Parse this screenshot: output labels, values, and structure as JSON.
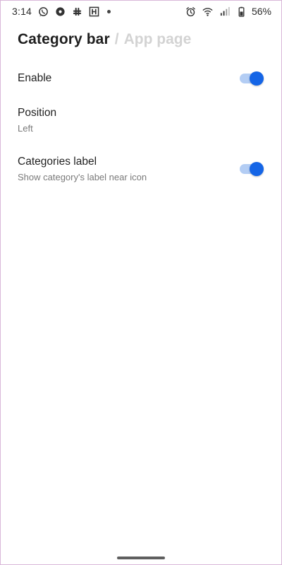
{
  "status_bar": {
    "time": "3:14",
    "battery_percent": "56%",
    "left_icons": [
      "whatsapp-icon",
      "lens-icon",
      "slack-icon",
      "hinge-icon"
    ],
    "right_icons": [
      "alarm-icon",
      "wifi-icon",
      "signal-icon",
      "battery-icon"
    ]
  },
  "header": {
    "title": "Category bar",
    "separator": "/",
    "subtitle": "App page"
  },
  "settings": {
    "enable": {
      "title": "Enable",
      "toggle_on": true
    },
    "position": {
      "title": "Position",
      "summary": "Left"
    },
    "categories_label": {
      "title": "Categories label",
      "summary": "Show category's label near icon",
      "toggle_on": true
    }
  },
  "colors": {
    "accent": "#1565e6",
    "toggle_track": "#b3cdf4",
    "title_inactive": "#d3d3d3"
  }
}
